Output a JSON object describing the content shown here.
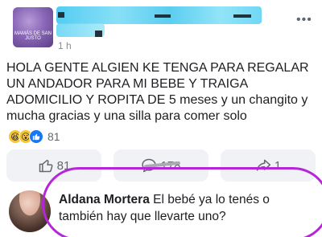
{
  "post": {
    "group_avatar_text": "MAMÁS DE SAN JUSTO",
    "time": "1 h",
    "more_icon": "ellipsis-icon",
    "text": "HOLA GENTE ALGIEN KE TENGA PARA REGALAR UN ANDADOR PARA MI BEBE Y TRAIGA ADOMICILIO Y ROPITA DE 5 meses y un changito y mucha gracias y una silla para comer solo",
    "reactions": {
      "icons": [
        "haha-icon",
        "wow-icon",
        "like-icon"
      ],
      "haha_glyph": "😆",
      "wow_glyph": "😮",
      "like_glyph": "👍",
      "count": "81"
    },
    "actions": {
      "like_count": "81",
      "comment_count": "178",
      "share_count": "1"
    }
  },
  "comment": {
    "author": "Aldana Mortera",
    "text": " El bebé ya lo tenés o también hay que llevarte uno?"
  },
  "colors": {
    "highlight": "#b526d9",
    "facebook_blue": "#1877f2",
    "name_redaction": "#41c7f0"
  }
}
